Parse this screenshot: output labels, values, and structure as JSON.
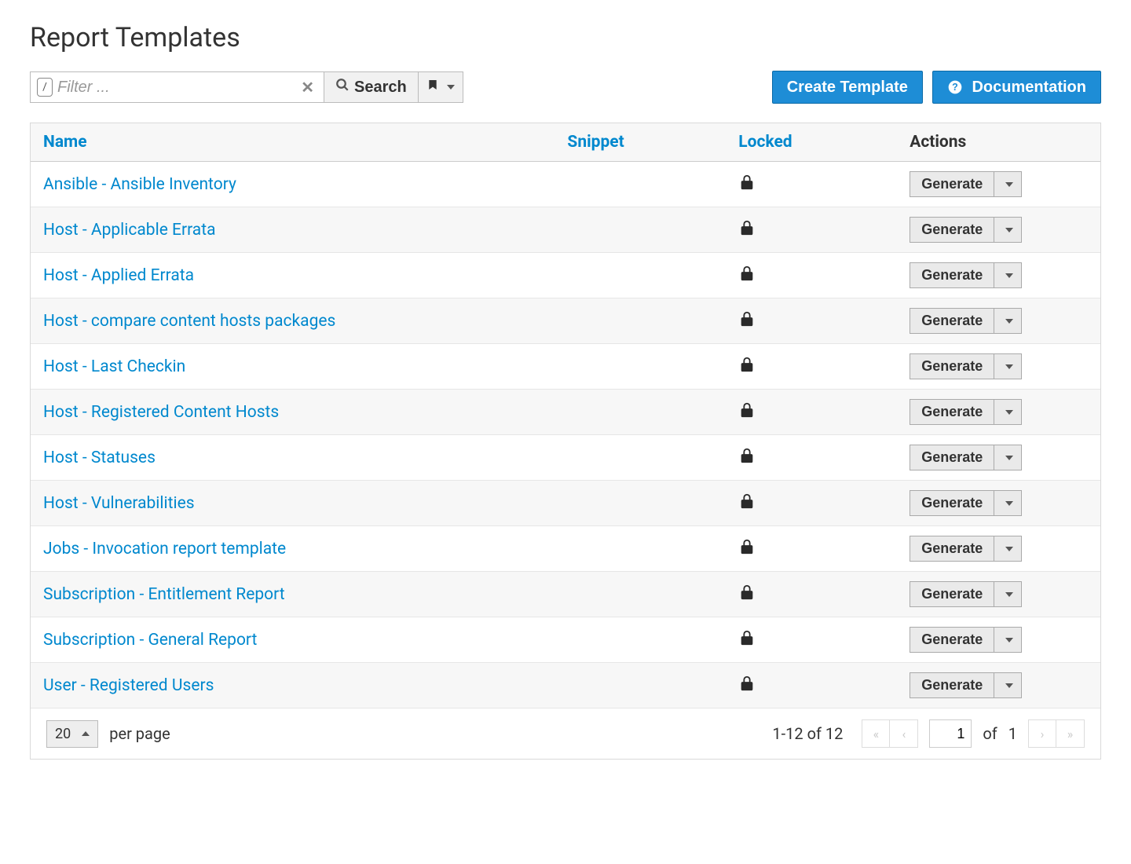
{
  "page": {
    "title": "Report Templates"
  },
  "toolbar": {
    "filter_placeholder": "Filter ...",
    "slash_key": "/",
    "search_label": "Search",
    "create_label": "Create Template",
    "documentation_label": "Documentation"
  },
  "table": {
    "headers": {
      "name": "Name",
      "snippet": "Snippet",
      "locked": "Locked",
      "actions": "Actions"
    },
    "generate_label": "Generate",
    "rows": [
      {
        "name": "Ansible - Ansible Inventory",
        "snippet": "",
        "locked": true
      },
      {
        "name": "Host - Applicable Errata",
        "snippet": "",
        "locked": true
      },
      {
        "name": "Host - Applied Errata",
        "snippet": "",
        "locked": true
      },
      {
        "name": "Host - compare content hosts packages",
        "snippet": "",
        "locked": true
      },
      {
        "name": "Host - Last Checkin",
        "snippet": "",
        "locked": true
      },
      {
        "name": "Host - Registered Content Hosts",
        "snippet": "",
        "locked": true
      },
      {
        "name": "Host - Statuses",
        "snippet": "",
        "locked": true
      },
      {
        "name": "Host - Vulnerabilities",
        "snippet": "",
        "locked": true
      },
      {
        "name": "Jobs - Invocation report template",
        "snippet": "",
        "locked": true
      },
      {
        "name": "Subscription - Entitlement Report",
        "snippet": "",
        "locked": true
      },
      {
        "name": "Subscription - General Report",
        "snippet": "",
        "locked": true
      },
      {
        "name": "User - Registered Users",
        "snippet": "",
        "locked": true
      }
    ]
  },
  "pagination": {
    "per_page_value": "20",
    "per_page_label": "per page",
    "range_text": "1-12 of  12",
    "current_page": "1",
    "of_label": "of",
    "total_pages": "1"
  }
}
